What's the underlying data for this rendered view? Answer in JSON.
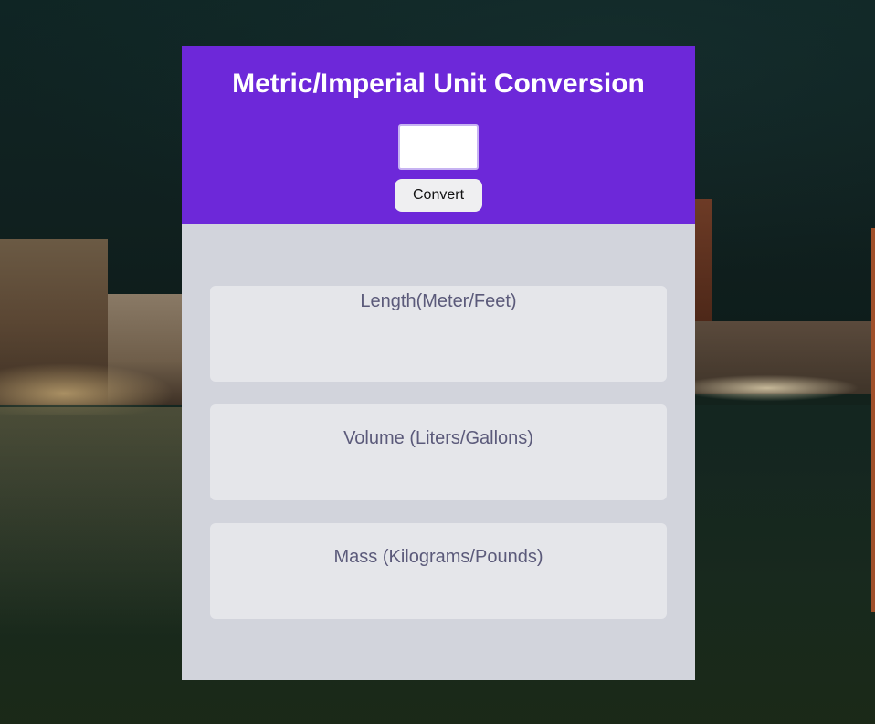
{
  "header": {
    "title": "Metric/Imperial Unit Conversion",
    "input_value": "",
    "input_placeholder": "",
    "convert_label": "Convert"
  },
  "results": {
    "length_title": "Length(Meter/Feet)",
    "volume_title": "Volume (Liters/Gallons)",
    "mass_title": "Mass (Kilograms/Pounds)"
  },
  "colors": {
    "header_background": "#6d28d9",
    "card_background": "#d2d4dc",
    "result_box_background": "#e5e6ea",
    "result_text": "#5b5a7a"
  }
}
